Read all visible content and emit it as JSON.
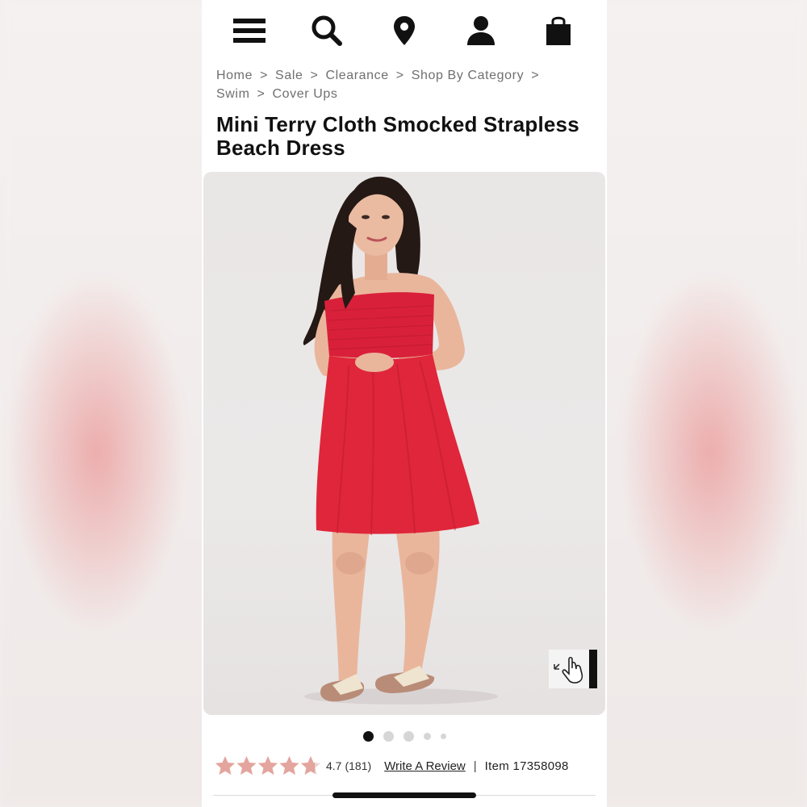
{
  "nav": {
    "icons": [
      "menu-icon",
      "search-icon",
      "location-pin-icon",
      "account-icon",
      "shopping-bag-icon"
    ]
  },
  "breadcrumb": {
    "items": [
      "Home",
      "Sale",
      "Clearance",
      "Shop By Category",
      "Swim",
      "Cover Ups"
    ],
    "separator": ">"
  },
  "product": {
    "title": "Mini Terry Cloth Smocked Strapless Beach Dress",
    "image_alt": "Model wearing red strapless smocked dress",
    "carousel": {
      "total": 5,
      "active": 1
    }
  },
  "reviews": {
    "rating": "4.7",
    "count": "(181)",
    "star_fill": 4.7,
    "write_label": "Write A Review",
    "separator": "|",
    "item_label": "Item 17358098"
  },
  "colors": {
    "star": "#e3a59d",
    "dress": "#e0263a",
    "text": "#111111"
  }
}
